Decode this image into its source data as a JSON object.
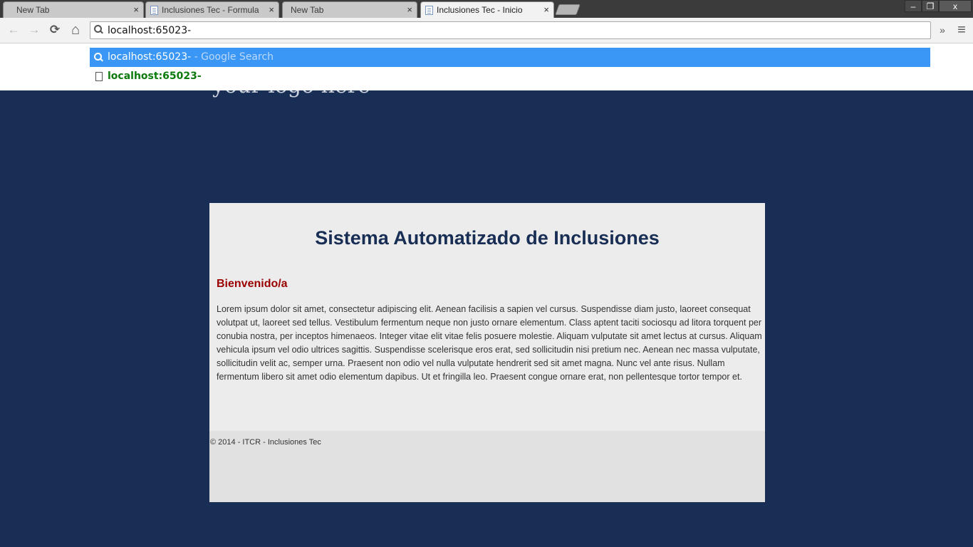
{
  "browser": {
    "tabs": [
      {
        "label": "New Tab",
        "active": false,
        "favicon": "none"
      },
      {
        "label": "Inclusiones Tec - Formula",
        "active": false,
        "favicon": "page-icon"
      },
      {
        "label": "New Tab",
        "active": false,
        "favicon": "none"
      },
      {
        "label": "Inclusiones Tec - Inicio",
        "active": true,
        "favicon": "page-icon"
      }
    ],
    "tab_close_glyph": "×",
    "window_controls": {
      "minimize": "–",
      "restore": "❐",
      "close": "x"
    },
    "toolbar": {
      "back": "←",
      "forward": "→",
      "reload": "⟳",
      "home": "⌂",
      "overflow": "»",
      "menu": "≡"
    },
    "omnibox": {
      "value": "localhost:65023-"
    },
    "suggestions": [
      {
        "text": "localhost:65023-",
        "hint": " - Google Search",
        "icon": "search-icon",
        "selected": true
      },
      {
        "text": "localhost:65023-",
        "hint": "",
        "icon": "page-icon",
        "selected": false
      }
    ]
  },
  "page": {
    "logo_text": "your logo here",
    "title": "Sistema Automatizado de Inclusiones",
    "welcome": "Bienvenido/a",
    "body": "Lorem ipsum dolor sit amet, consectetur adipiscing elit. Aenean facilisis a sapien vel cursus. Suspendisse diam justo, laoreet consequat volutpat ut, laoreet sed tellus. Vestibulum fermentum neque non justo ornare elementum. Class aptent taciti sociosqu ad litora torquent per conubia nostra, per inceptos himenaeos. Integer vitae elit vitae felis posuere molestie. Aliquam vulputate sit amet lectus at cursus. Aliquam vehicula ipsum vel odio ultrices sagittis. Suspendisse scelerisque eros erat, sed sollicitudin nisi pretium nec. Aenean nec massa vulputate, sollicitudin velit ac, semper urna. Praesent non odio vel nulla vulputate hendrerit sed sit amet magna. Nunc vel ante risus. Nullam fermentum libero sit amet odio elementum dapibus. Ut et fringilla leo. Praesent congue ornare erat, non pellentesque tortor tempor et.",
    "footer": "© 2014 - ITCR - Inclusiones Tec"
  },
  "colors": {
    "page_background": "#182e55",
    "content_background": "#ececec",
    "title": "#182e55",
    "welcome": "#9a0000",
    "suggestion_highlight": "#3a97f6",
    "url_suggestion": "#0c7a0c"
  }
}
